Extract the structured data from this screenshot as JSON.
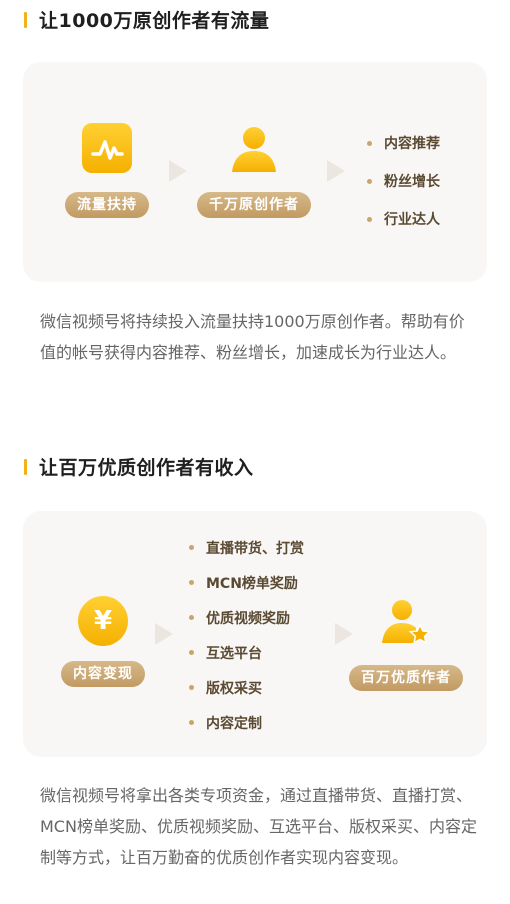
{
  "section1": {
    "title": "让1000万原创作者有流量",
    "flow": {
      "step1_label": "流量扶持",
      "step2_label": "千万原创作者"
    },
    "outcomes": [
      "内容推荐",
      "粉丝增长",
      "行业达人"
    ],
    "description": "微信视频号将持续投入流量扶持1000万原创作者。帮助有价值的帐号获得内容推荐、粉丝增长，加速成长为行业达人。"
  },
  "section2": {
    "title": "让百万优质创作者有收入",
    "flow": {
      "step1_label": "内容变现",
      "step1_icon_glyph": "¥",
      "step2_label": "百万优质作者"
    },
    "channels": [
      "直播带货、打赏",
      "MCN榜单奖励",
      "优质视频奖励",
      "互选平台",
      "版权采买",
      "内容定制"
    ],
    "description": "微信视频号将拿出各类专项资金，通过直播带货、直播打赏、MCN榜单奖励、优质视频奖励、互选平台、版权采买、内容定制等方式，让百万勤奋的优质创作者实现内容变现。"
  },
  "colors": {
    "accent": "#f2b21a",
    "pill": "#c9a56b",
    "card_bg": "#f8f7f5",
    "body_text": "#666666"
  }
}
